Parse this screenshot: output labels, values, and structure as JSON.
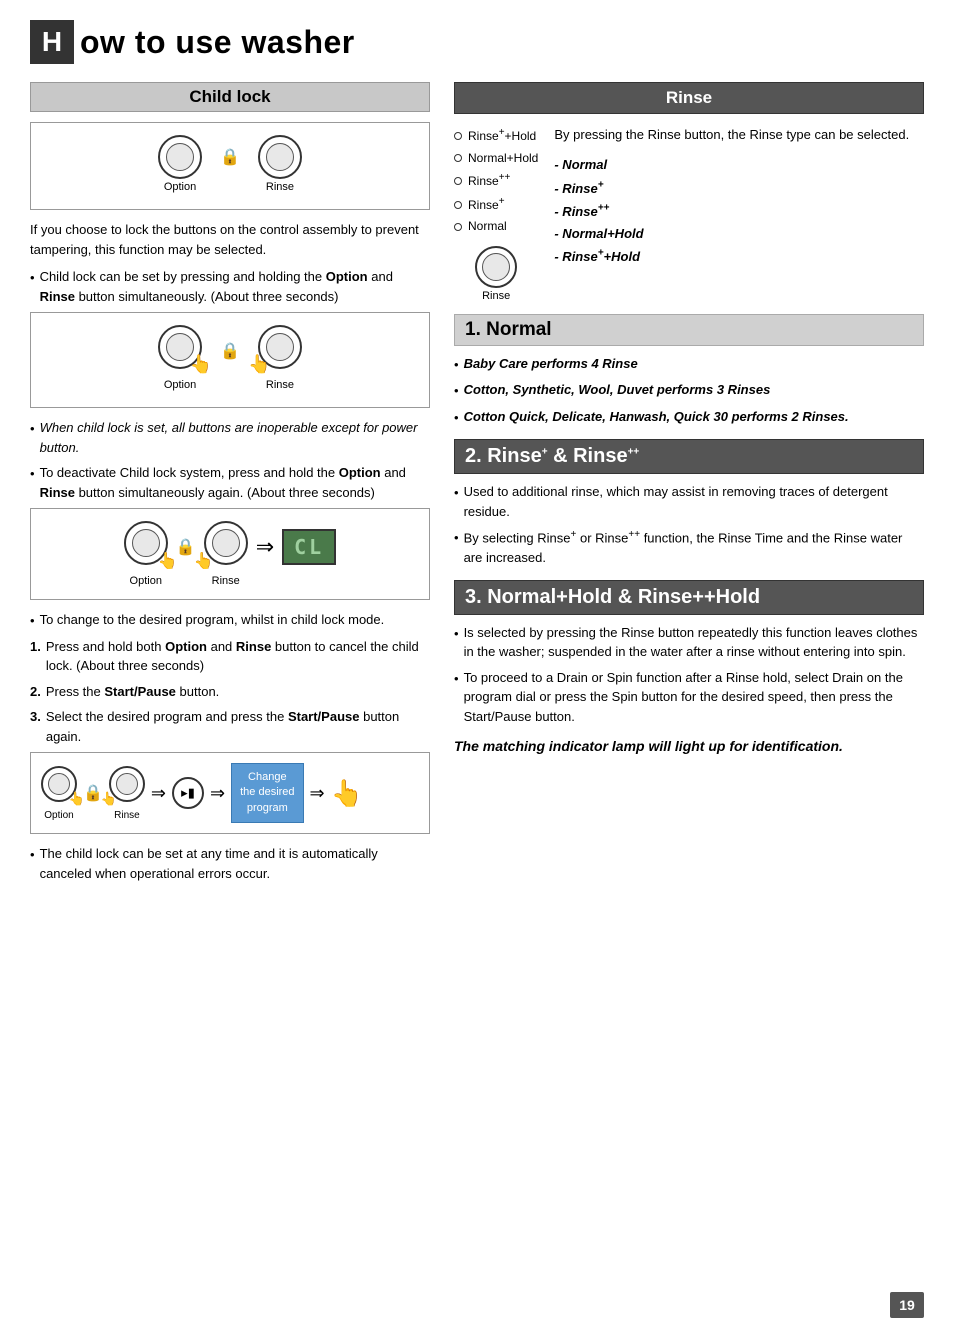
{
  "header": {
    "box_letter": "H",
    "title": "ow to use washer"
  },
  "left_column": {
    "section_title": "Child lock",
    "diagram1": {
      "label_option": "Option",
      "label_rinse": "Rinse"
    },
    "intro_text": "If you choose to lock the buttons on the control assembly to prevent tampering, this function may be selected.",
    "bullet1": "Child lock can be set by pressing and holding the Option and Rinse button simultaneously. (About three seconds)",
    "diagram2": {
      "label_option": "Option",
      "label_rinse": "Rinse"
    },
    "bullet2": "When child lock is set, all buttons are inoperable except for power button.",
    "bullet3_prefix": "To deactivate Child lock system, press and hold the ",
    "bullet3_option": "Option",
    "bullet3_mid": " and ",
    "bullet3_rinse": "Rinse",
    "bullet3_suffix": " button simultaneously again. (About three seconds)",
    "diagram3": {
      "label_option": "Option",
      "label_rinse": "Rinse",
      "lcd_text": "CL"
    },
    "bullet4": "To change to the desired program, whilst in child lock mode.",
    "numbered_items": [
      {
        "num": "1",
        "text_prefix": "Press and hold both ",
        "bold1": "Option",
        "mid": " and ",
        "bold2": "Rinse",
        "suffix": " button to cancel the child lock. (About three seconds)"
      },
      {
        "num": "2",
        "text_prefix": "Press the ",
        "bold1": "Start/Pause",
        "suffix": " button."
      },
      {
        "num": "3",
        "text_prefix": "Select the desired program and press the ",
        "bold1": "Start/Pause",
        "suffix": " button again."
      }
    ],
    "bullet5": "The child lock can be set at any time and it is automatically canceled when operational errors occur."
  },
  "right_column": {
    "rinse_section": {
      "title": "Rinse",
      "indicator_items": [
        "Rinse⁺+Hold",
        "Normal+Hold",
        "Rinse⁺⁺",
        "Rinse⁺",
        "Normal"
      ],
      "rinse_button_label": "Rinse",
      "description": "By pressing the Rinse button, the Rinse type can be selected.",
      "options": [
        "- Normal",
        "- Rinse⁺",
        "- Rinse⁺⁺",
        "- Normal+Hold",
        "- Rinse⁺+Hold"
      ]
    },
    "section1": {
      "title": "1. Normal",
      "bullets": [
        "Baby Care performs 4 Rinse",
        "Cotton, Synthetic, Wool, Duvet performs 3 Rinses",
        "Cotton Quick, Delicate, Hanwash, Quick 30 performs 2 Rinses."
      ]
    },
    "section2": {
      "title": "2. Rinse⁺ & Rinse⁺⁺",
      "bullets": [
        "Used to additional rinse, which may assist in removing traces of detergent residue.",
        "By selecting Rinse⁺ or Rinse⁺⁺ function, the Rinse Time and the Rinse water are increased."
      ]
    },
    "section3": {
      "title": "3. Normal+Hold & Rinse++Hold",
      "bullets": [
        "Is selected by pressing the Rinse button repeatedly this function leaves clothes in the washer; suspended in the water after a rinse without entering into spin.",
        "To proceed to a Drain or Spin function after a Rinse hold, select Drain on the program dial or  press the Spin button for the desired speed, then press the Start/Pause button."
      ],
      "footer_italic": "The matching indicator lamp will light up for identification."
    }
  },
  "page_number": "19"
}
